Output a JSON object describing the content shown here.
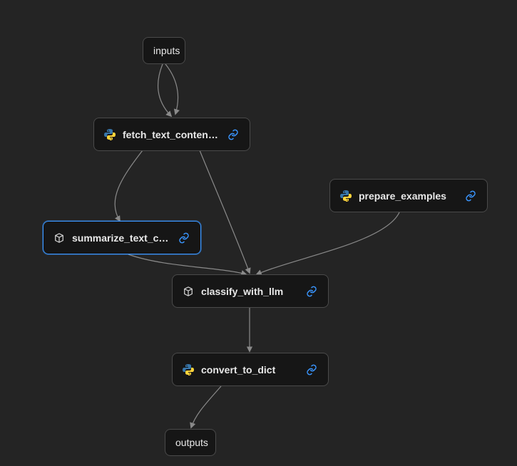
{
  "nodes": {
    "inputs": {
      "label": "inputs"
    },
    "fetch": {
      "label": "fetch_text_content_fro…",
      "icon": "python",
      "link": true
    },
    "prepare": {
      "label": "prepare_examples",
      "icon": "python",
      "link": true
    },
    "summarize": {
      "label": "summarize_text_content",
      "icon": "cube",
      "link": true,
      "selected": true
    },
    "classify": {
      "label": "classify_with_llm",
      "icon": "cube",
      "link": true
    },
    "convert": {
      "label": "convert_to_dict",
      "icon": "python",
      "link": true
    },
    "outputs": {
      "label": "outputs"
    }
  },
  "colors": {
    "link_icon": "#3a96ff",
    "node_bg": "#161616",
    "canvas_bg": "#242424"
  }
}
